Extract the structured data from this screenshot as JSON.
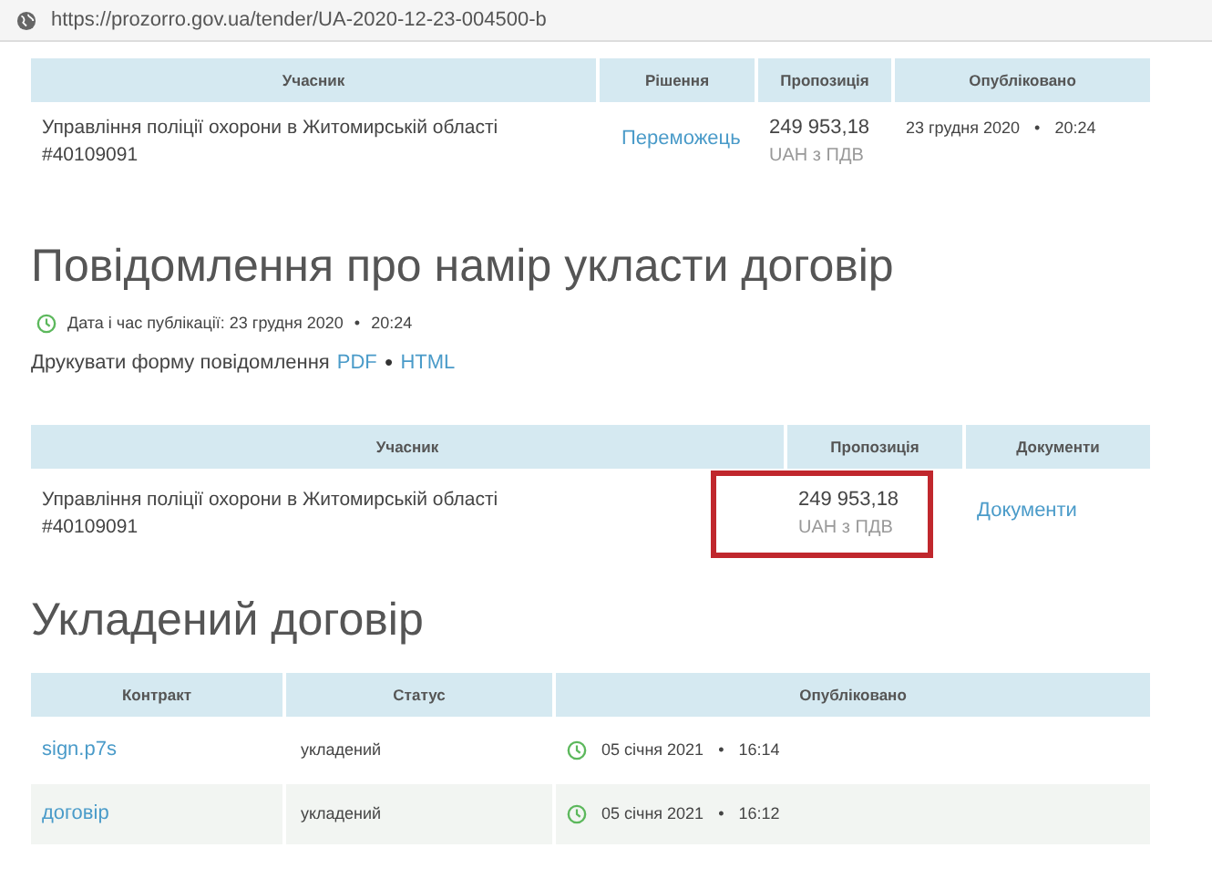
{
  "address_bar": {
    "url": "https://prozorro.gov.ua/tender/UA-2020-12-23-004500-b"
  },
  "awards_table": {
    "columns": [
      "Учасник",
      "Рішення",
      "Пропозиція",
      "Опубліковано"
    ],
    "rows": [
      {
        "participant": "Управління поліції охорони в Житомирській області #40109091",
        "decision": "Переможець",
        "amount": "249 953,18",
        "currency": "UAH з ПДВ",
        "published": "23 грудня 2020",
        "separator": "•",
        "time": "20:24"
      }
    ]
  },
  "notice": {
    "title": "Повідомлення про намір укласти договір",
    "date_label": "Дата і час публікації: 23 грудня 2020",
    "separator": "•",
    "time": "20:24",
    "print_label": "Друкувати форму повідомлення",
    "links": [
      "PDF",
      "HTML"
    ],
    "link_separator": "●",
    "table": {
      "columns": [
        "Учасник",
        "Пропозиція",
        "Документи"
      ],
      "rows": [
        {
          "participant": "Управління поліції охорони в Житомирській області #40109091",
          "amount": "249 953,18",
          "currency": "UAH з ПДВ",
          "documents": "Документи",
          "highlighted": true
        }
      ]
    }
  },
  "contract": {
    "title": "Укладений договір",
    "columns": [
      "Контракт",
      "Статус",
      "Опубліковано"
    ],
    "rows": [
      {
        "name": "sign.p7s",
        "status": "укладений",
        "published": "05 січня 2021",
        "separator": "•",
        "time": "16:14"
      },
      {
        "name": "договір",
        "status": "укладений",
        "published": "05 січня 2021",
        "separator": "•",
        "time": "16:12"
      }
    ]
  }
}
